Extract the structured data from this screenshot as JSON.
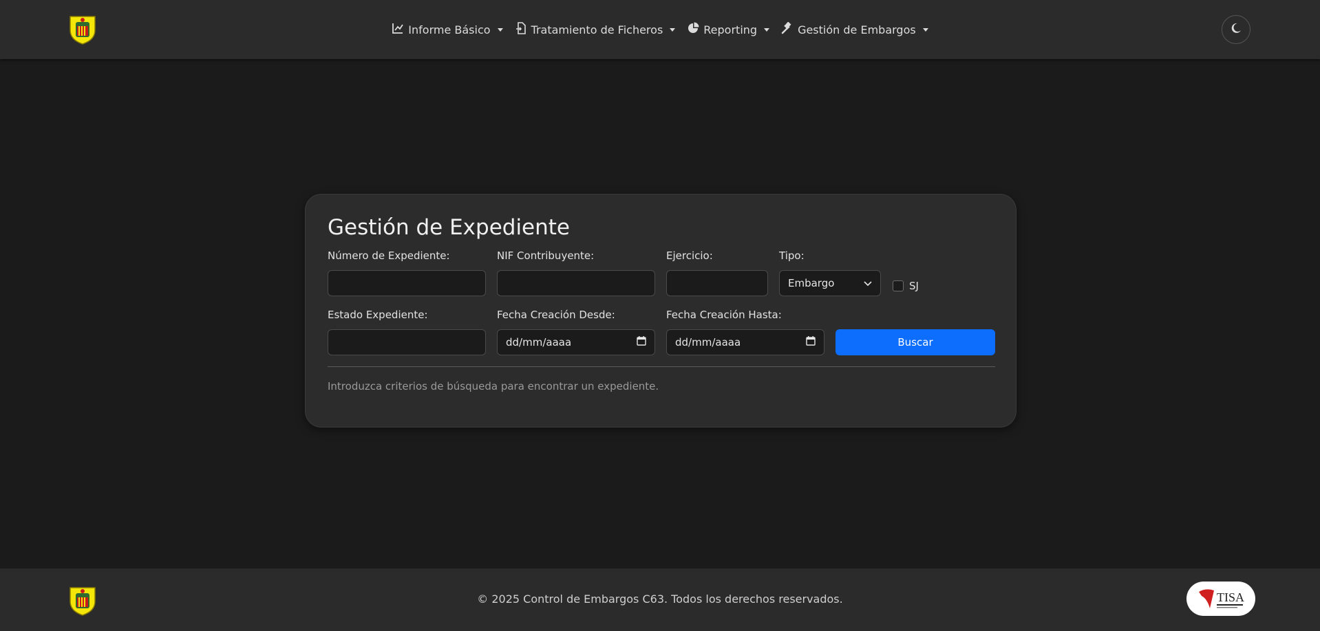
{
  "navbar": {
    "items": [
      {
        "label": "Informe Básico",
        "icon": "chart-line-icon"
      },
      {
        "label": "Tratamiento de Ficheros",
        "icon": "file-import-icon"
      },
      {
        "label": "Reporting",
        "icon": "pie-chart-icon"
      },
      {
        "label": "Gestión de Embargos",
        "icon": "gavel-icon"
      }
    ],
    "theme_toggle_icon": "moon-icon"
  },
  "form": {
    "title": "Gestión de Expediente",
    "numero_expediente": {
      "label": "Número de Expediente:",
      "value": ""
    },
    "nif": {
      "label": "NIF Contribuyente:",
      "value": ""
    },
    "ejercicio": {
      "label": "Ejercicio:",
      "value": ""
    },
    "tipo": {
      "label": "Tipo:",
      "selected": "Embargo"
    },
    "sj": {
      "label": "SJ",
      "checked": false
    },
    "estado": {
      "label": "Estado Expediente:",
      "value": ""
    },
    "fecha_desde": {
      "label": "Fecha Creación Desde:",
      "placeholder": "dd/mm/aaaa"
    },
    "fecha_hasta": {
      "label": "Fecha Creación Hasta:",
      "placeholder": "dd/mm/aaaa"
    },
    "search_button": "Buscar",
    "hint": "Introduzca criterios de búsqueda para encontrar un expediente."
  },
  "footer": {
    "text": "© 2025 Control de Embargos C63. Todos los derechos reservados.",
    "partner_logo_text": "TISA"
  },
  "colors": {
    "background": "#1b1b1b",
    "navbar": "#2b2b2b",
    "card": "#2c2c2c",
    "primary": "#0d6efd",
    "crest_yellow": "#f5e60a"
  }
}
